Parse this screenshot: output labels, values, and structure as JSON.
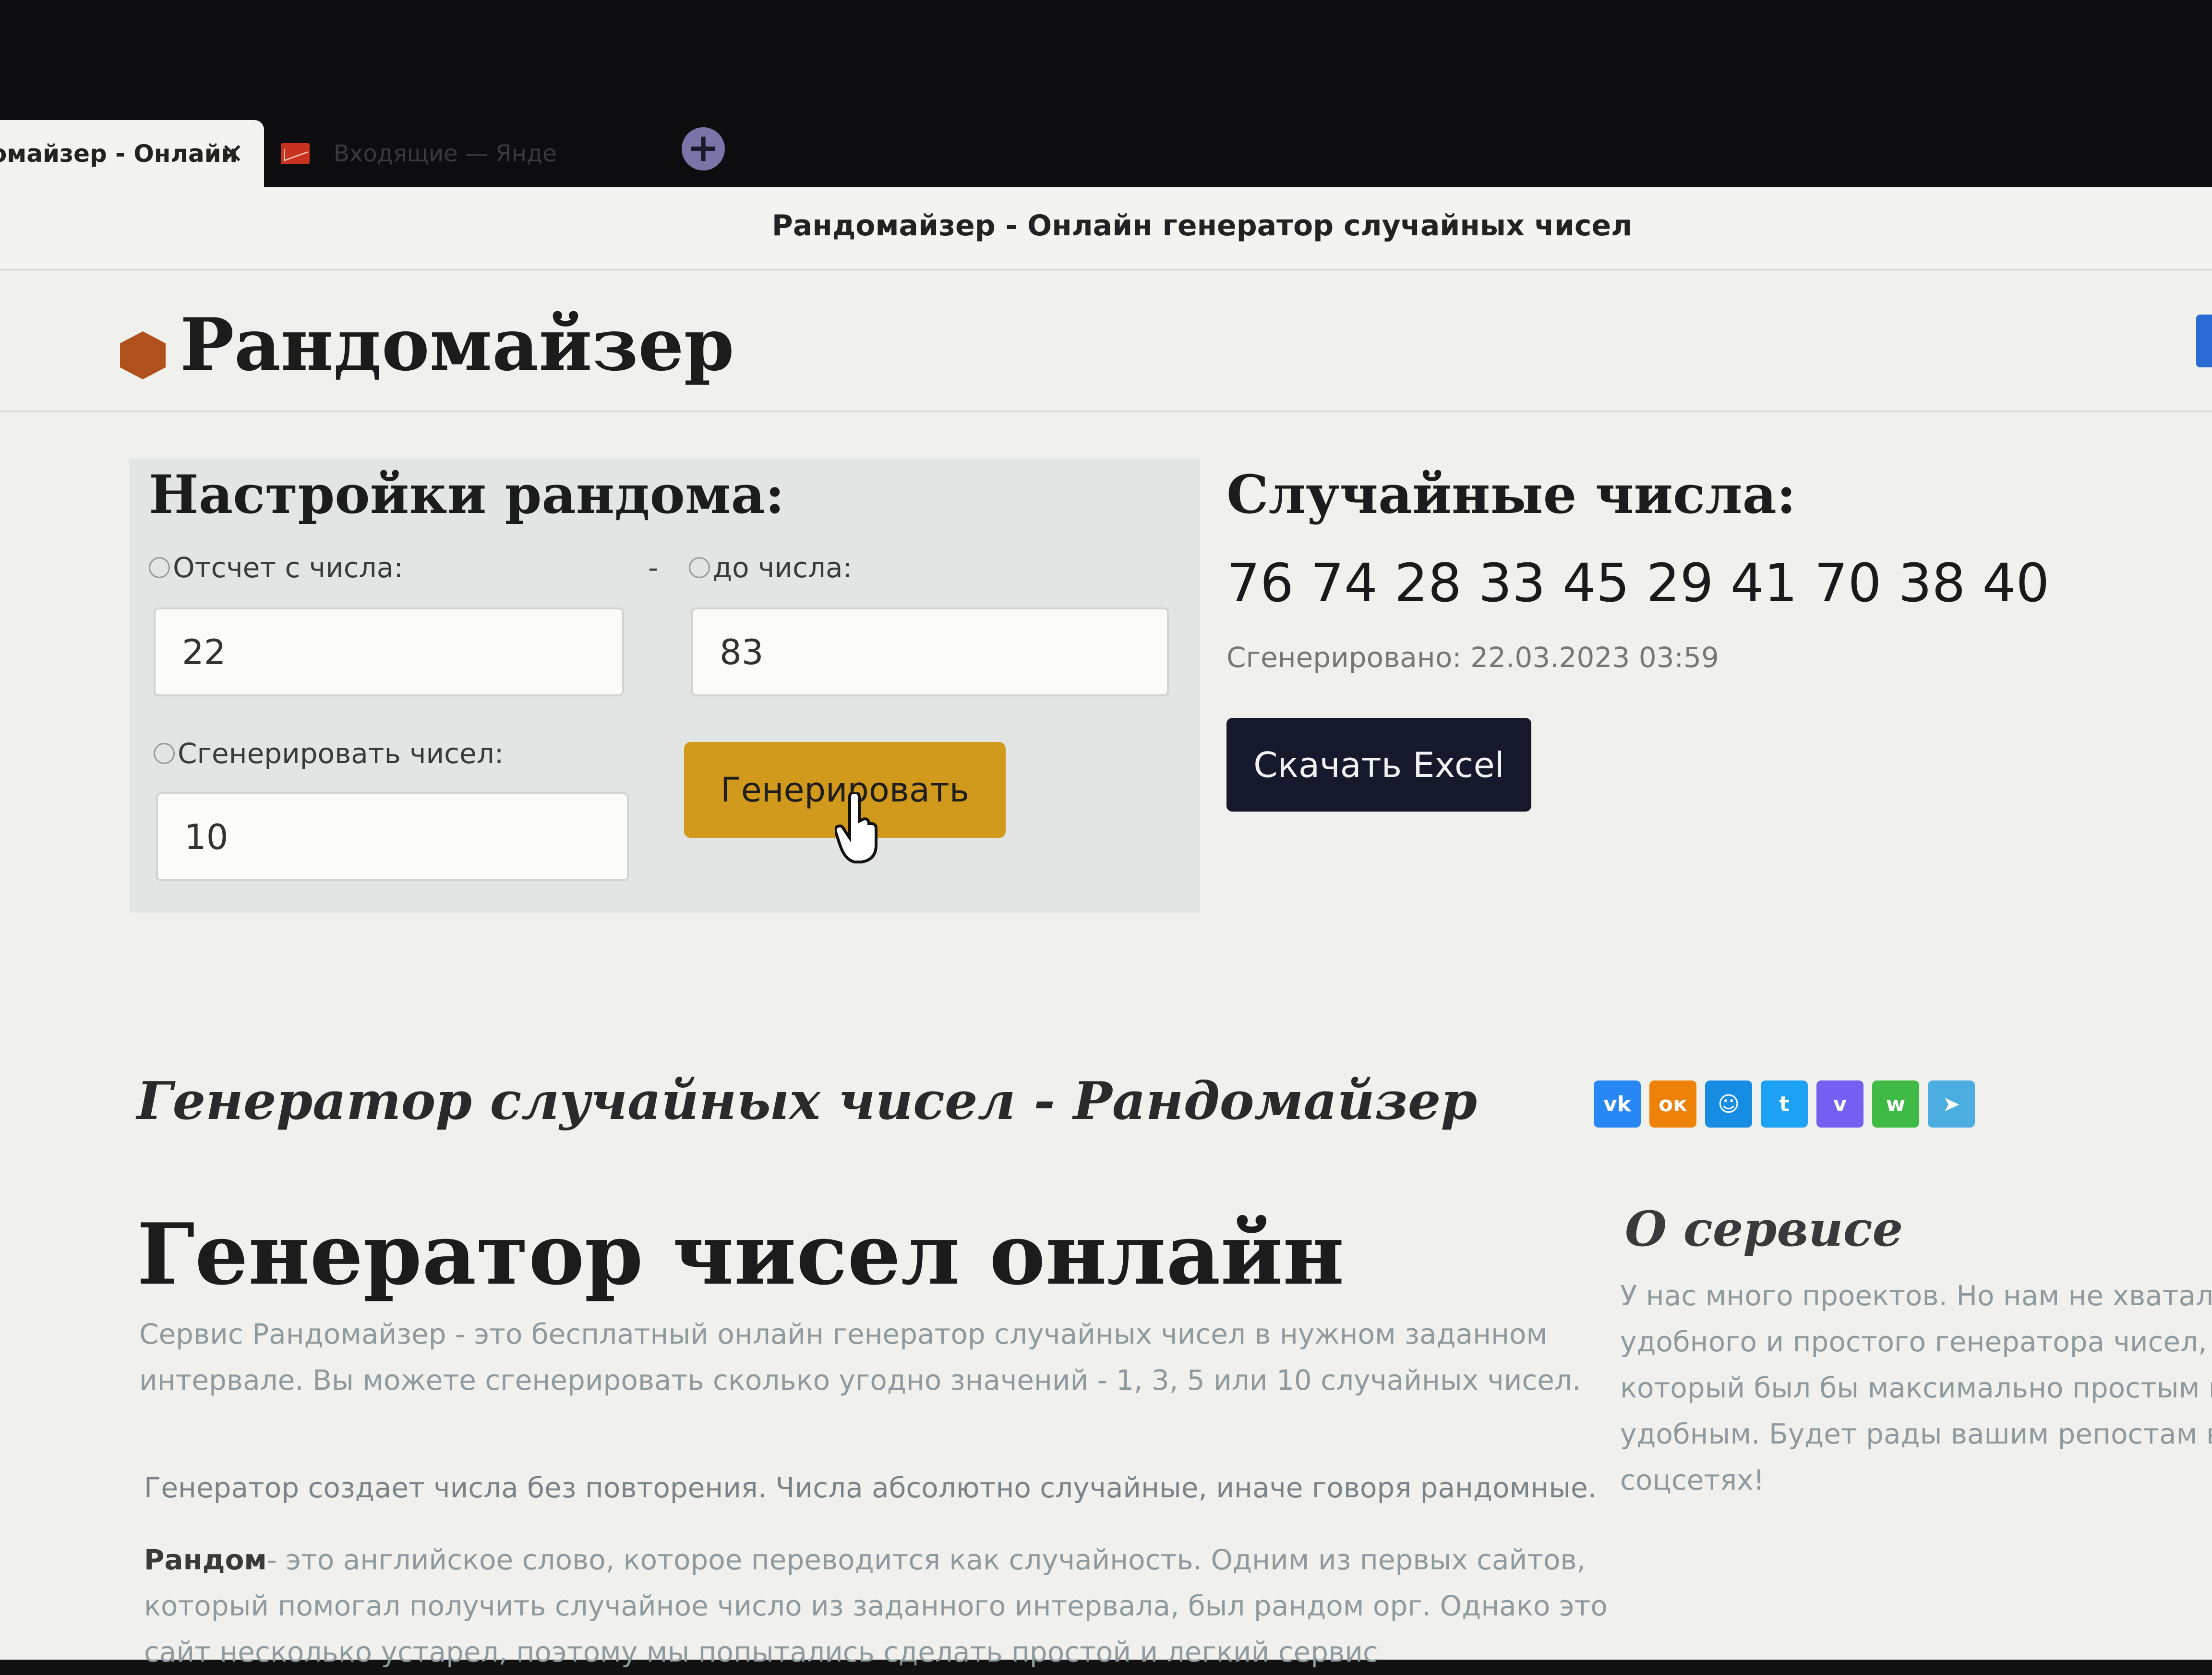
{
  "browser": {
    "active_tab_title": "омайзер - Онлайн",
    "active_tab_close": "✕",
    "second_tab_title": "Входящие — Янде",
    "new_tab_symbol": "+",
    "window_title": "Рандомайзер - Онлайн генератор случайных чисел"
  },
  "header": {
    "logo": "Рандомайзер"
  },
  "settings": {
    "title": "Настройки рандома:",
    "from_label": "Отсчет с числа:",
    "dash": "-",
    "to_label": "до числа:",
    "from_value": "22",
    "to_value": "83",
    "count_label": "Сгенерировать чисел:",
    "count_value": "10",
    "generate_button": "Генерировать"
  },
  "results": {
    "title": "Случайные числа:",
    "numbers": "76 74 28 33 45 29 41 70 38 40",
    "generated_at": "Сгенерировано: 22.03.2023 03:59",
    "excel_button": "Скачать Excel"
  },
  "content": {
    "subtitle": "Генератор случайных чисел - Рандомайзер",
    "share": [
      {
        "label": "vk",
        "color": "#2787f5"
      },
      {
        "label": "ок",
        "color": "#ee8208"
      },
      {
        "label": "☺",
        "color": "#168de2"
      },
      {
        "label": "t",
        "color": "#1da1f2"
      },
      {
        "label": "v",
        "color": "#7360f2"
      },
      {
        "label": "w",
        "color": "#3fbb45"
      },
      {
        "label": "➤",
        "color": "#4caee0"
      }
    ],
    "main_title": "Генератор чисел онлайн",
    "p1_line1": "Сервис Рандомайзер - это бесплатный онлайн генератор случайных чисел в нужном заданном",
    "p1_line2": "интервале. Вы можете сгенерировать сколько угодно значений - 1, 3, 5 или 10 случайных чисел.",
    "p2": "Генератор создает числа без повторения. Числа абсолютно случайные, иначе говоря рандомные.",
    "p3_bold": "Рандом",
    "p3_line1": "- это английское слово, которое переводится как случайность. Одним из первых сайтов,",
    "p3_line2": "который помогал получить случайное число из заданного интервала, был рандом орг. Однако это",
    "p3_line3": "сайт несколько устарел, поэтому мы попытались сделать простой и легкий сервис",
    "about_title": "О сервисе",
    "about_line1": "У нас много проектов. Но нам не хватало",
    "about_line2": "удобного и простого генератора чисел,",
    "about_line3": "который был бы максимально простым и",
    "about_line4": "удобным. Будет рады вашим репостам в",
    "about_line5": "соцсетях!"
  }
}
